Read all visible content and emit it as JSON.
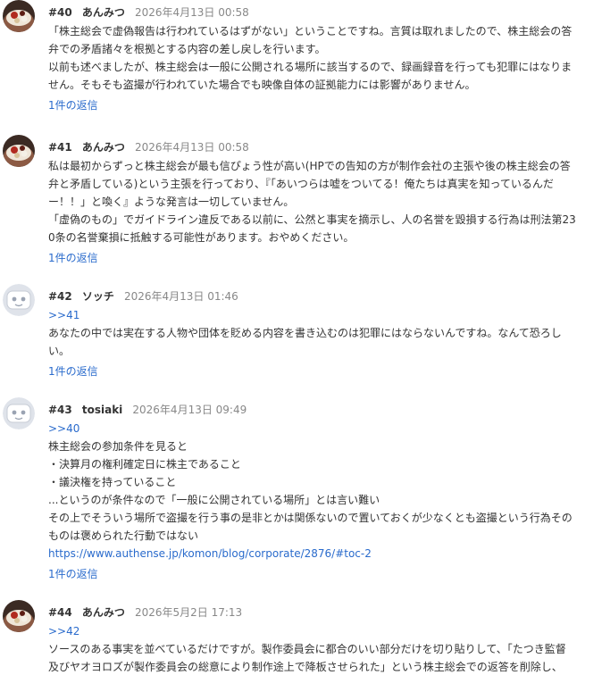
{
  "comments": [
    {
      "number": "#40",
      "author": "あんみつ",
      "date": "2026年4月13日 00:58",
      "avatar": "anmitsu",
      "lines": [
        "「株主総会で虚偽報告は行われているはずがない」ということですね。言質は取れましたので、株主総会の答",
        "弁での矛盾諸々を根拠とする内容の差し戻しを行います。",
        "以前も述べましたが、株主総会は一般に公開される場所に該当するので、録画録音を行っても犯罪にはなりま",
        "せん。そもそも盗撮が行われていた場合でも映像自体の証拠能力には影響がありません。"
      ],
      "replies": "1件の返信"
    },
    {
      "number": "#41",
      "author": "あんみつ",
      "date": "2026年4月13日 00:58",
      "avatar": "anmitsu",
      "lines": [
        "私は最初からずっと株主総会が最も信ぴょう性が高い(HPでの告知の方が制作会社の主張や後の株主総会の答",
        "弁と矛盾している)という主張を行っており、『「あいつらは嘘をついてる！俺たちは真実を知っているんだ",
        "ー！！」と喚く』ような発言は一切していません。",
        "「虚偽のもの」でガイドライン違反である以前に、公然と事実を摘示し、人の名誉を毀損する行為は刑法第23",
        "0条の名誉棄損に抵触する可能性があります。おやめください。"
      ],
      "replies": "1件の返信"
    },
    {
      "number": "#42",
      "author": "ソッチ",
      "date": "2026年4月13日 01:46",
      "avatar": "default",
      "anchor": ">>41",
      "lines": [
        "あなたの中では実在する人物や団体を貶める内容を書き込むのは犯罪にはならないんですね。なんて恐ろし",
        "い。"
      ],
      "replies": "1件の返信"
    },
    {
      "number": "#43",
      "author": "tosiaki",
      "date": "2026年4月13日 09:49",
      "avatar": "default",
      "anchor": ">>40",
      "lines": [
        "株主総会の参加条件を見ると",
        "・決算月の権利確定日に株主であること",
        "・議決権を持っていること",
        "...というのが条件なので「一般に公開されている場所」とは言い難い",
        "その上でそういう場所で盗撮を行う事の是非とかは関係ないので置いておくが少なくとも盗撮という行為その",
        "ものは褒められた行動ではない"
      ],
      "link": "https://www.authense.jp/komon/blog/corporate/2876/#toc-2",
      "replies": "1件の返信"
    },
    {
      "number": "#44",
      "author": "あんみつ",
      "date": "2026年5月2日 17:13",
      "avatar": "anmitsu",
      "anchor": ">>42",
      "lines": [
        "ソースのある事実を並べているだけですが。製作委員会に都合のいい部分だけを切り貼りして、「たつき監督",
        "及びヤオヨロズが製作委員会の総意により制作途上で降板させられた」という株主総会での返答を削除し、"
      ]
    }
  ],
  "colors": {
    "text": "#333333",
    "meta": "#888888",
    "link": "#2a6bcc",
    "default_avatar_bg": "#dfe3ea"
  }
}
